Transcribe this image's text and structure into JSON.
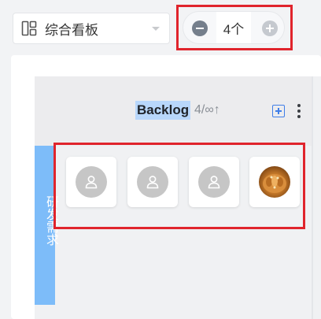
{
  "toolbar": {
    "view_select": {
      "icon": "layout-grid-icon",
      "label": "综合看板"
    },
    "member_counter": {
      "value": "4个",
      "minus_icon": "minus-circle-icon",
      "plus_icon": "plus-circle-icon"
    }
  },
  "column": {
    "title": "Backlog",
    "count": "4/∞",
    "sort_glyph": "↑",
    "add_icon": "add-square-icon",
    "more_icon": "more-vertical-icon"
  },
  "swimlane": {
    "label": "研发需求"
  },
  "cards": [
    {
      "avatar": "user-placeholder-icon"
    },
    {
      "avatar": "user-placeholder-icon"
    },
    {
      "avatar": "user-placeholder-icon"
    },
    {
      "avatar": "photo-avatar"
    }
  ],
  "colors": {
    "highlight_frame": "#e0242c",
    "lane": "#7dbcf9",
    "title_selection": "#b8d7fb",
    "accent": "#3f7ee8"
  }
}
